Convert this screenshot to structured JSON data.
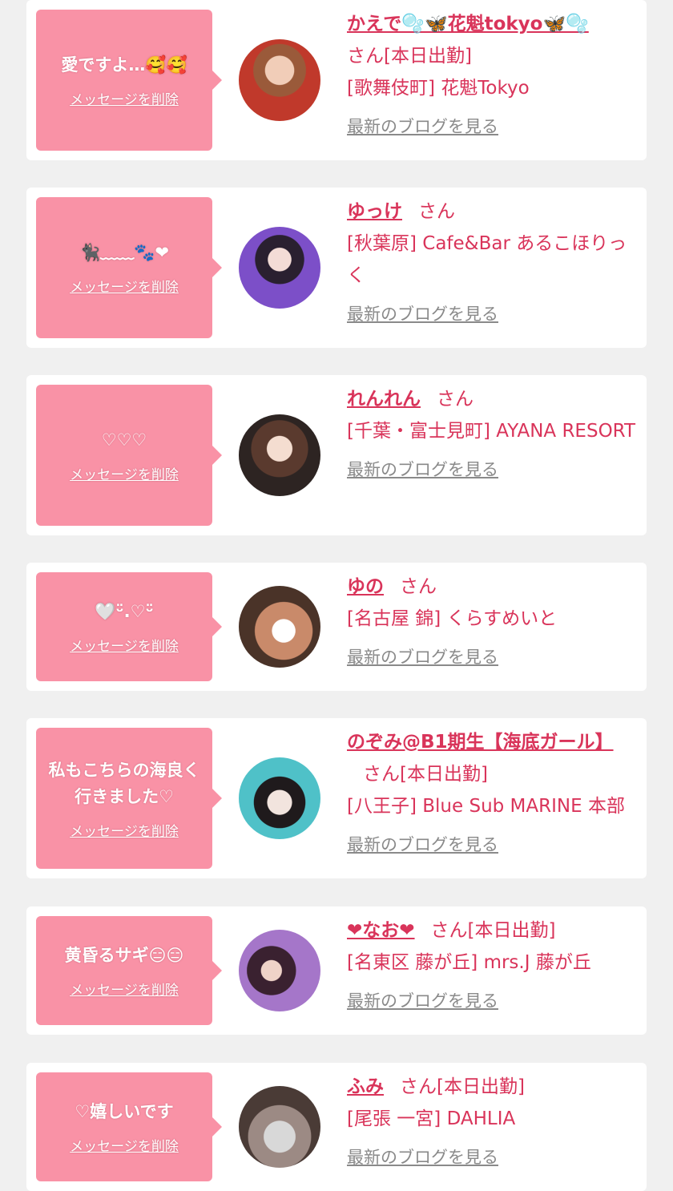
{
  "colors": {
    "background": "#f0f0f0",
    "card": "#ffffff",
    "bubble": "#f992a6",
    "accent_text": "#d9345a",
    "link_gray": "#8a8a8a"
  },
  "common": {
    "delete_label": "メッセージを削除",
    "blog_label": "最新のブログを見る"
  },
  "messages": [
    {
      "message": "愛ですよ…🥰🥰",
      "name": "かえで🫧🦋花魁tokyo🦋🫧",
      "suffix": "さん[本日出勤]",
      "shop": "[歌舞伎町] 花魁Tokyo"
    },
    {
      "message": "🐈‍⬛﹏﹏🐾❤",
      "name": "ゆっけ",
      "suffix": "さん",
      "shop": "[秋葉原] Cafe&Bar あるこほりっく"
    },
    {
      "message": "♡♡♡",
      "name": "れんれん",
      "suffix": "さん",
      "shop": "[千葉・富士見町] AYANA RESORT"
    },
    {
      "message": "🤍ᵕ̈.♡ᵕ̈",
      "name": "ゆの",
      "suffix": "さん",
      "shop": "[名古屋 錦] くらすめいと"
    },
    {
      "message": "私もこちらの海良く行きました♡",
      "name": "のぞみ@B1期生【海底ガール】",
      "suffix": "さん[本日出勤]",
      "shop": "[八王子] Blue Sub MARINE 本部"
    },
    {
      "message": "黄昏るサギ😑😑",
      "name": "❤なお❤",
      "suffix": "さん[本日出勤]",
      "shop": "[名東区 藤が丘] mrs.J 藤が丘"
    },
    {
      "message": "♡嬉しいです",
      "name": "ふみ",
      "suffix": "さん[本日出勤]",
      "shop": "[尾張 一宮] DAHLIA"
    }
  ]
}
